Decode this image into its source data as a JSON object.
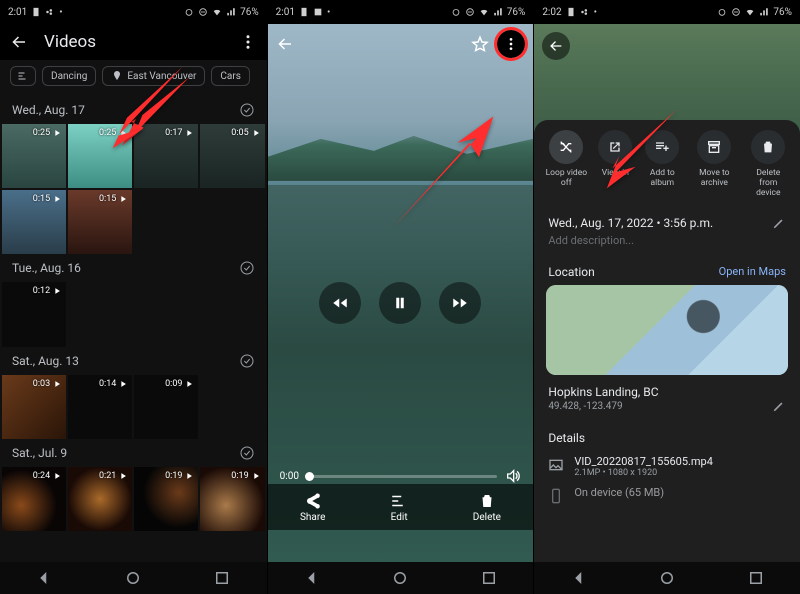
{
  "statusbar": {
    "time": "2:01",
    "time3": "2:02",
    "battery": "76%"
  },
  "panel1": {
    "title": "Videos",
    "chips": {
      "a": "Dancing",
      "b": "East Vancouver",
      "c": "Cars"
    },
    "dates": {
      "d1": "Wed., Aug. 17",
      "d2": "Tue., Aug. 16",
      "d3": "Sat., Aug. 13",
      "d4": "Sat., Jul. 9"
    },
    "durs": {
      "r1": [
        "0:25",
        "0:25",
        "0:17",
        "0:05"
      ],
      "r2": [
        "0:15",
        "0:15"
      ],
      "r3a": [
        "0:12"
      ],
      "r3b": [
        "0:03",
        "0:14",
        "0:09"
      ],
      "r4": [
        "0:24",
        "0:21",
        "0:19",
        "0:19"
      ]
    }
  },
  "panel2": {
    "time_elapsed": "0:00",
    "actions": {
      "share": "Share",
      "edit": "Edit",
      "delete": "Delete"
    }
  },
  "panel3": {
    "actions": {
      "loop": "Loop video off",
      "viewin": "View in",
      "addalbum": "Add to album",
      "archive": "Move to archive",
      "delete": "Delete from device"
    },
    "datetime": "Wed., Aug. 17, 2022 • 3:56 p.m.",
    "add_desc": "Add description...",
    "location_hdr": "Location",
    "open_maps": "Open in Maps",
    "loc_name": "Hopkins Landing, BC",
    "coords": "49.428, -123.479",
    "details_hdr": "Details",
    "filename": "VID_20220817_155605.mp4",
    "filesub": "2.1MP • 1080 x 1920",
    "ondevice": "On device (65 MB)"
  }
}
